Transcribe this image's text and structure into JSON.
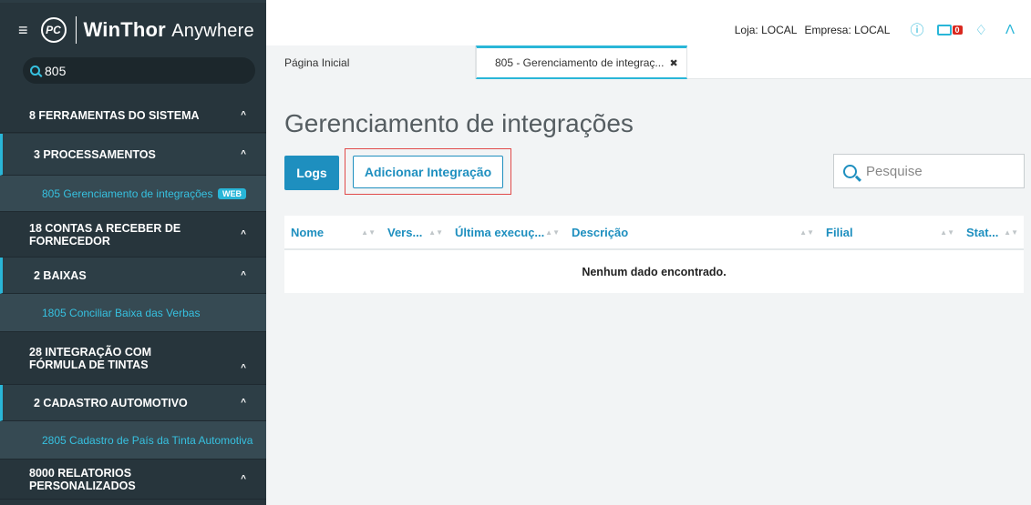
{
  "app": {
    "logo_text": "PC",
    "brand_bold": "WinThor",
    "brand_light": "Anywhere"
  },
  "sidebar": {
    "search_value": "805",
    "items": [
      {
        "label": "8  FERRAMENTAS DO SISTEMA",
        "kind": "section"
      },
      {
        "label": "3  PROCESSAMENTOS",
        "kind": "sub"
      },
      {
        "label": "805  Gerenciamento de integrações",
        "kind": "leaf",
        "badge": "WEB"
      },
      {
        "label": "18  CONTAS A RECEBER DE FORNECEDOR",
        "kind": "section"
      },
      {
        "label": "2  BAIXAS",
        "kind": "sub"
      },
      {
        "label": "1805  Conciliar Baixa das Verbas",
        "kind": "leaf"
      },
      {
        "label": "28  INTEGRAÇÃO COM FÓRMULA DE TINTAS",
        "kind": "section"
      },
      {
        "label": "2  CADASTRO AUTOMOTIVO",
        "kind": "sub"
      },
      {
        "label": "2805  Cadastro de País da Tinta Automotiva",
        "kind": "leaf"
      },
      {
        "label": "8000  RELATORIOS PERSONALIZADOS",
        "kind": "section"
      }
    ]
  },
  "header": {
    "loja": "Loja: LOCAL",
    "empresa": "Empresa: LOCAL",
    "mail_count": "0"
  },
  "tabs": [
    {
      "label": "Página Inicial"
    },
    {
      "label": "805 - Gerenciamento de integraç..."
    }
  ],
  "main": {
    "title": "Gerenciamento de integrações",
    "logs_label": "Logs",
    "add_label": "Adicionar Integração",
    "search_placeholder": "Pesquise",
    "columns": [
      "Nome",
      "Vers...",
      "Última execuç...",
      "Descrição",
      "Filial",
      "Stat..."
    ],
    "empty_message": "Nenhum dado encontrado."
  },
  "colors": {
    "accent": "#29b6d8",
    "primary_button": "#1e8fbf",
    "sidebar_bg": "#27353c",
    "highlight_box": "#e14a4a",
    "badge_red": "#d9281f"
  }
}
